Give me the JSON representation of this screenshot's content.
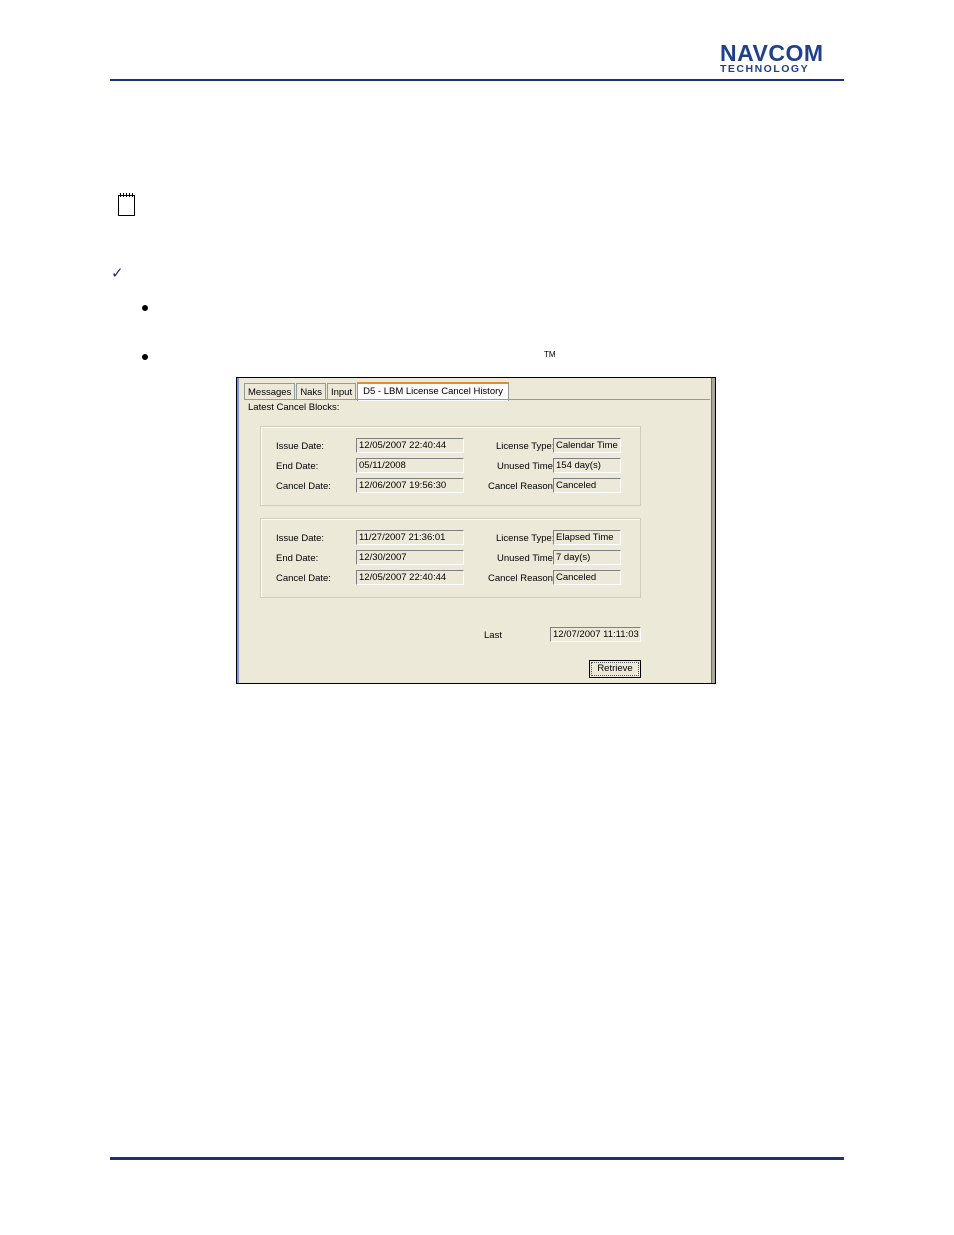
{
  "logo": {
    "top": "NAVCOM",
    "bottom": "TECHNOLOGY"
  },
  "trademark": "TM",
  "check_glyph": "✓",
  "icons": {
    "note": "notepad-icon",
    "check": "checkmark-icon",
    "bullet": "bullet-icon"
  },
  "colors": {
    "brand": "#1f3f8f",
    "rule": "#1f2f7f",
    "dialog_bg": "#ece9d8",
    "active_tab_accent": "#e68b2c"
  },
  "dialog": {
    "tabs": [
      {
        "label": "Messages",
        "active": false
      },
      {
        "label": "Naks",
        "active": false
      },
      {
        "label": "Input",
        "active": false
      },
      {
        "label": "D5 - LBM License Cancel History",
        "active": true
      }
    ],
    "heading": "Latest Cancel Blocks:",
    "labels": {
      "issue_date": "Issue Date:",
      "end_date": "End Date:",
      "cancel_date": "Cancel Date:",
      "license_type": "License Type:",
      "unused_time": "Unused Time:",
      "cancel_reason": "Cancel Reason:"
    },
    "blocks": [
      {
        "issue_date": "12/05/2007 22:40:44",
        "end_date": "05/11/2008",
        "cancel_date": "12/06/2007 19:56:30",
        "license_type": "Calendar Time",
        "unused_time": "154 day(s)",
        "cancel_reason": "Canceled"
      },
      {
        "issue_date": "11/27/2007 21:36:01",
        "end_date": "12/30/2007",
        "cancel_date": "12/05/2007 22:40:44",
        "license_type": "Elapsed Time",
        "unused_time": "7 day(s)",
        "cancel_reason": "Canceled"
      }
    ],
    "last_label": "Last",
    "last_value": "12/07/2007 11:11:03",
    "retrieve_label": "Retrieve"
  }
}
